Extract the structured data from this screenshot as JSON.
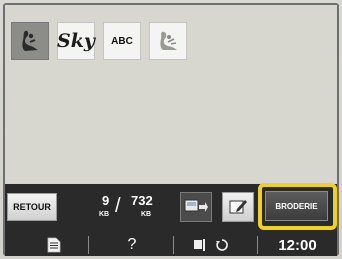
{
  "patterns": [
    {
      "id": "embroidery-figure",
      "selected": true,
      "icon": "figure-sewing-icon"
    },
    {
      "id": "sky-font",
      "label": "Sky",
      "selected": false
    },
    {
      "id": "abc-font",
      "label": "ABC",
      "selected": false
    },
    {
      "id": "embroidery-motif",
      "selected": false,
      "icon": "embroidery-motif-icon"
    }
  ],
  "toolbar": {
    "retour_label": "RETOUR",
    "used_memory_value": "9",
    "used_memory_unit": "KB",
    "total_memory_value": "732",
    "total_memory_unit": "KB",
    "broderie_label": "BRODERIE"
  },
  "statusbar": {
    "help_label": "?",
    "time": "12:00"
  },
  "colors": {
    "highlight": "#f0d21c",
    "background": "#d7d7d0",
    "toolbar": "#2a2a2a"
  }
}
